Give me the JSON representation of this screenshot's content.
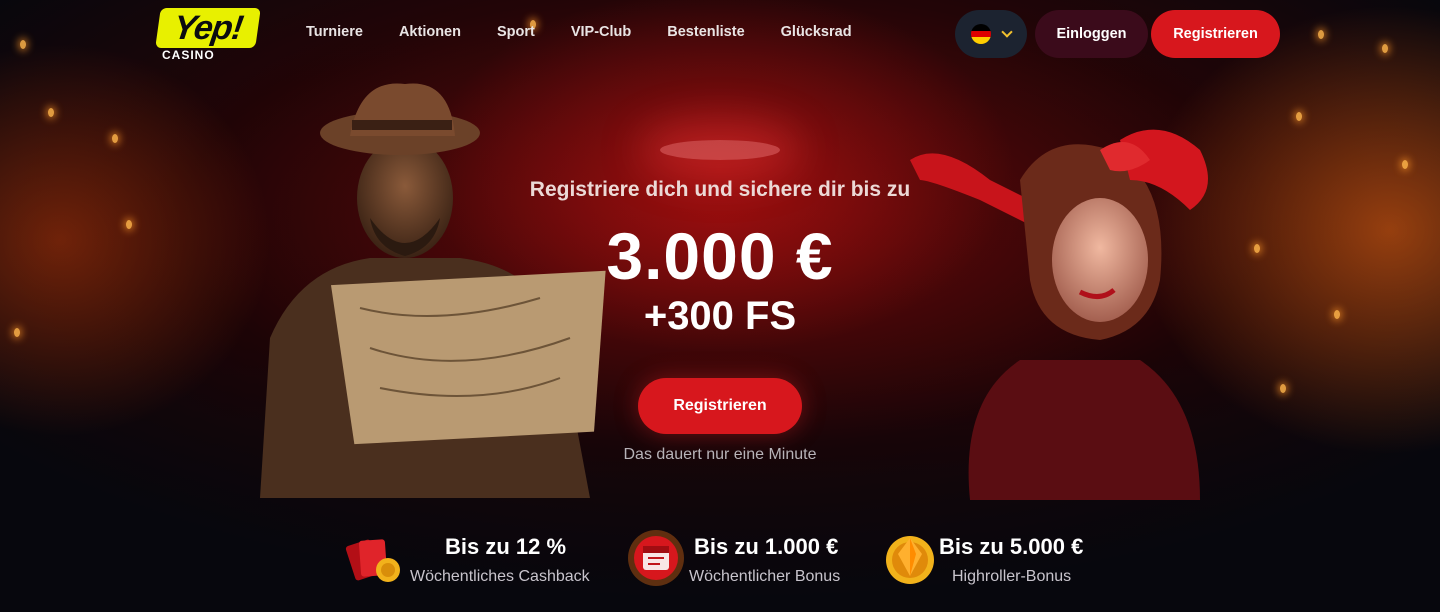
{
  "brand": {
    "logo_text": "Yep!",
    "logo_sub": "CASINO",
    "accent": "#e8f000",
    "primary_red": "#d7171d"
  },
  "nav": {
    "items": [
      {
        "label": "Turniere"
      },
      {
        "label": "Aktionen"
      },
      {
        "label": "Sport"
      },
      {
        "label": "VIP-Club"
      },
      {
        "label": "Bestenliste"
      },
      {
        "label": "Glücksrad"
      }
    ]
  },
  "header": {
    "language_icon": "germany-flag-icon",
    "login_label": "Einloggen",
    "register_label": "Registrieren"
  },
  "hero": {
    "tagline": "Registriere dich und sichere dir bis zu",
    "amount": "3.000 €",
    "free_spins": "+300 FS",
    "cta_label": "Registrieren",
    "note": "Das dauert nur eine Minute"
  },
  "features": [
    {
      "icon": "cashback-cards-icon",
      "title": "Bis zu 12 %",
      "subtitle": "Wöchentliches Cashback"
    },
    {
      "icon": "bonus-calendar-icon",
      "title": "Bis zu 1.000 €",
      "subtitle": "Wöchentlicher Bonus"
    },
    {
      "icon": "highroller-gem-icon",
      "title": "Bis zu 5.000 €",
      "subtitle": "Highroller-Bonus"
    }
  ]
}
